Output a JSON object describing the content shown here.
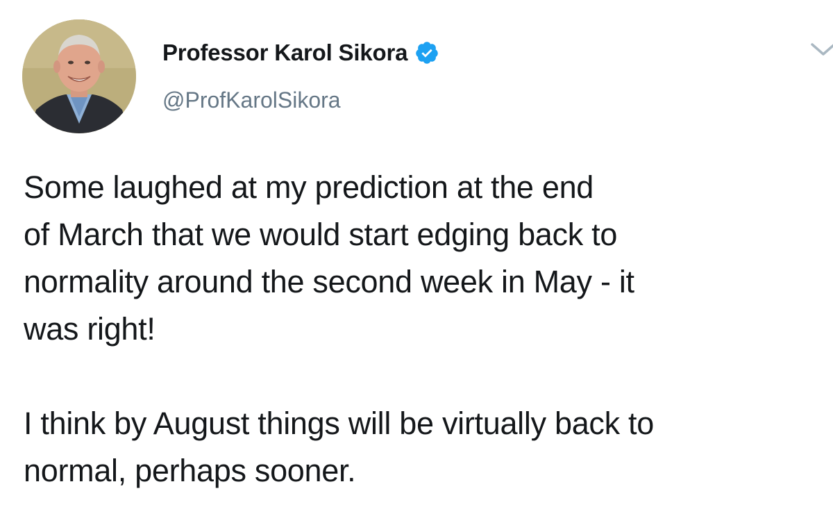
{
  "tweet": {
    "author": {
      "display_name": "Professor Karol Sikora",
      "handle": "@ProfKarolSikora",
      "verified": true,
      "avatar_icon": "profile-photo"
    },
    "menu_icon": "chevron-down-icon",
    "accent_color": "#1da1f2",
    "paragraphs": [
      {
        "lines": [
          "Some laughed at my prediction at the end",
          "of March that we would start edging back to",
          "normality around the second week in May - it",
          "was right!"
        ]
      },
      {
        "lines": [
          "I think by August things will be virtually back to",
          "normal, perhaps sooner."
        ]
      }
    ]
  }
}
